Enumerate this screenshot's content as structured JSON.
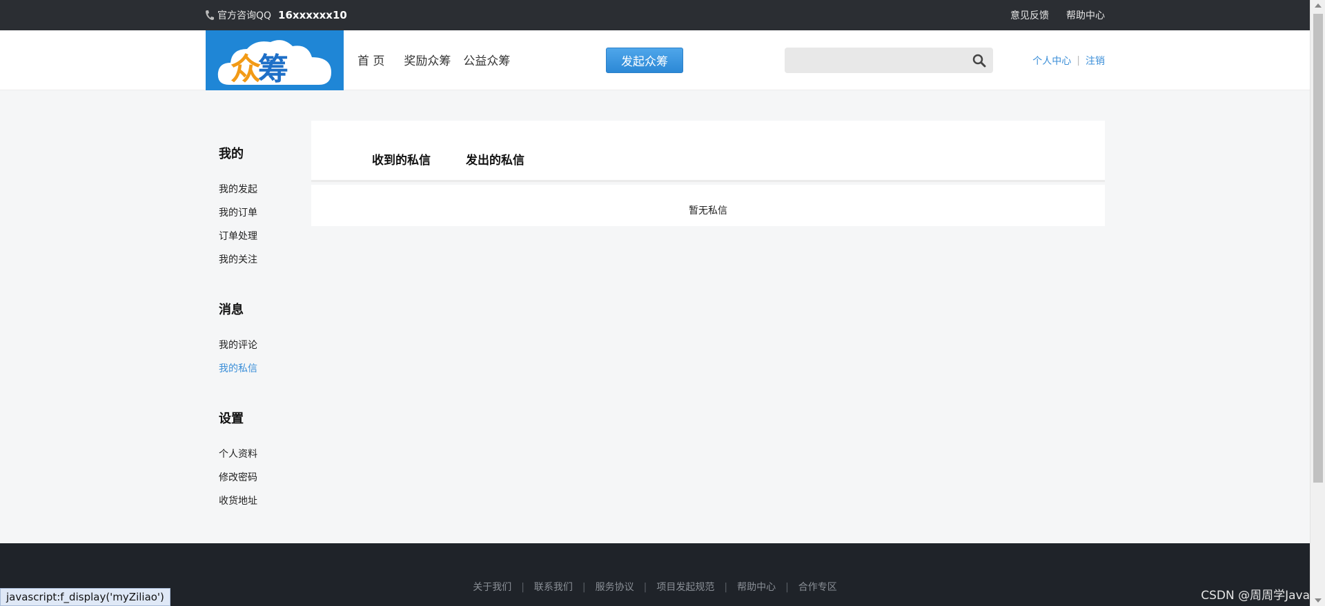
{
  "topbar": {
    "phone_label": "官方咨询QQ",
    "phone_number": "16xxxxxx10",
    "links": [
      "意见反馈",
      "帮助中心"
    ]
  },
  "header": {
    "logo_text_a": "众",
    "logo_text_b": "筹",
    "nav": [
      "首 页",
      "奖励众筹",
      "公益众筹"
    ],
    "launch_button": "发起众筹",
    "search_placeholder": "",
    "user_center": "个人中心",
    "logout": "注销"
  },
  "sidebar": {
    "sections": [
      {
        "title": "我的",
        "items": [
          "我的发起",
          "我的订单",
          "订单处理",
          "我的关注"
        ]
      },
      {
        "title": "消息",
        "items": [
          "我的评论",
          "我的私信"
        ]
      },
      {
        "title": "设置",
        "items": [
          "个人资料",
          "修改密码",
          "收货地址"
        ]
      }
    ],
    "active_item": "我的私信"
  },
  "main": {
    "tabs": [
      "收到的私信",
      "发出的私信"
    ],
    "empty_message": "暂无私信"
  },
  "footer": {
    "links": [
      "关于我们",
      "联系我们",
      "服务协议",
      "项目发起规范",
      "帮助中心",
      "合作专区"
    ]
  },
  "statusbar": {
    "text": "javascript:f_display('myZiliao')"
  },
  "watermark": {
    "text": "CSDN @周周学Java"
  },
  "colors": {
    "accent": "#3a8ed8",
    "topbar": "#2b2e33",
    "footer": "#1f2329",
    "logo_bg": "#1f86d6"
  }
}
